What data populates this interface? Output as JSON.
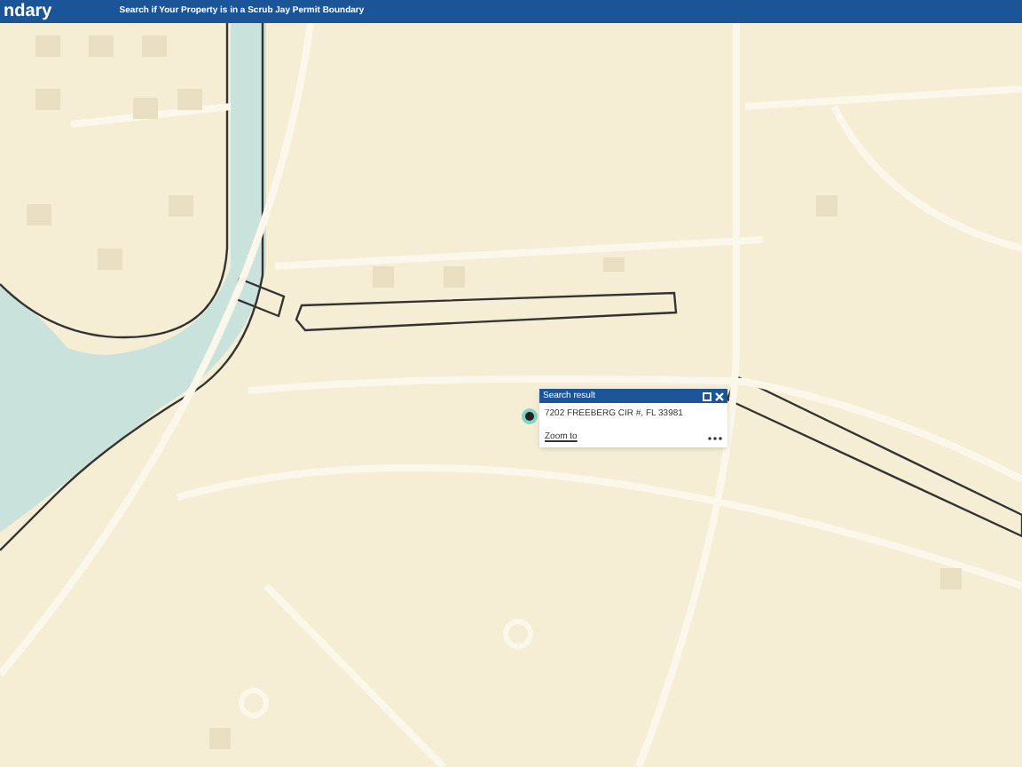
{
  "header": {
    "title": "ndary",
    "subtitle": "Search if Your Property is in a Scrub Jay Permit Boundary"
  },
  "popup": {
    "title": "Search result",
    "address": "7202 FREEBERG CIR #, FL 33981",
    "link": "Zoom to"
  }
}
